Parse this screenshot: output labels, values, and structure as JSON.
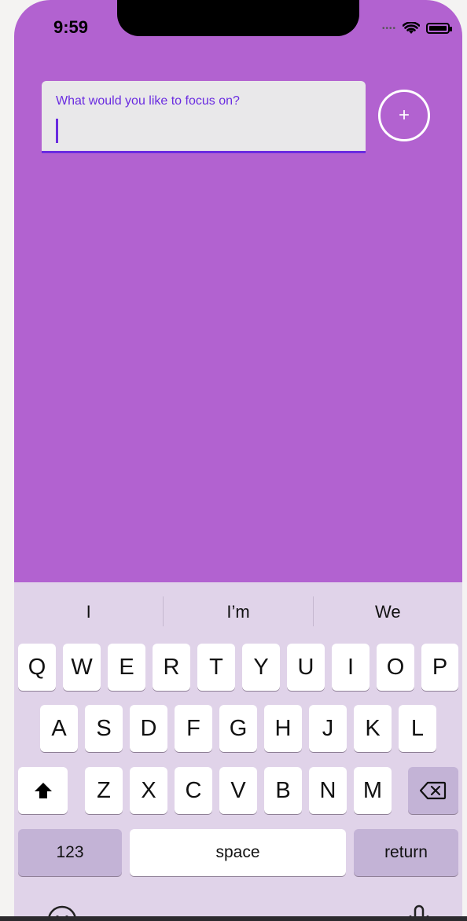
{
  "status_bar": {
    "time": "9:59",
    "signal_dots": "••••"
  },
  "focus_input": {
    "label": "What would you like to focus on?",
    "value": ""
  },
  "add_button": {
    "label": "+"
  },
  "keyboard": {
    "suggestions": [
      "I",
      "I’m",
      "We"
    ],
    "row1": [
      "Q",
      "W",
      "E",
      "R",
      "T",
      "Y",
      "U",
      "I",
      "O",
      "P"
    ],
    "row2": [
      "A",
      "S",
      "D",
      "F",
      "G",
      "H",
      "J",
      "K",
      "L"
    ],
    "row3": [
      "Z",
      "X",
      "C",
      "V",
      "B",
      "N",
      "M"
    ],
    "numbers_label": "123",
    "space_label": "space",
    "return_label": "return"
  },
  "colors": {
    "background": "#b262d0",
    "accent": "#6a2ce0",
    "keyboard": "#e0d3e9"
  }
}
